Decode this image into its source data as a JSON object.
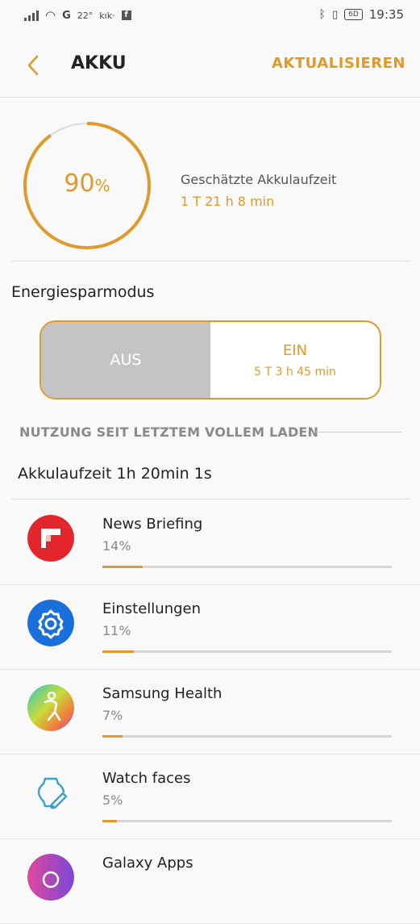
{
  "status_bar": {
    "temperature": "22°",
    "carrier_text": "kık·",
    "battery_badge": "6D",
    "time": "19:35"
  },
  "header": {
    "title": "AKKU",
    "refresh_label": "AKTUALISIEREN"
  },
  "battery": {
    "percent_value": "90",
    "percent_unit": "%",
    "level_fraction": 0.9,
    "estimate_label": "Geschätzte Akkulaufzeit",
    "estimate_value": "1 T 21 h 8 min",
    "accent_color": "#e09a2b"
  },
  "power_saving": {
    "section_title": "Energiesparmodus",
    "off_label": "AUS",
    "on_label": "EIN",
    "on_estimate": "5 T 3 h 45 min"
  },
  "usage": {
    "header": "NUTZUNG SEIT LETZTEM VOLLEM LADEN",
    "runtime": "Akkulaufzeit 1h 20min 1s"
  },
  "apps": [
    {
      "name": "News Briefing",
      "percent": "14%",
      "fraction": 0.14,
      "icon": "flipboard-icon"
    },
    {
      "name": "Einstellungen",
      "percent": "11%",
      "fraction": 0.11,
      "icon": "settings-gear-icon"
    },
    {
      "name": "Samsung Health",
      "percent": "7%",
      "fraction": 0.07,
      "icon": "samsung-health-icon"
    },
    {
      "name": "Watch faces",
      "percent": "5%",
      "fraction": 0.05,
      "icon": "watch-face-icon"
    },
    {
      "name": "Galaxy Apps",
      "percent": "",
      "fraction": 0,
      "icon": "galaxy-apps-icon"
    }
  ]
}
